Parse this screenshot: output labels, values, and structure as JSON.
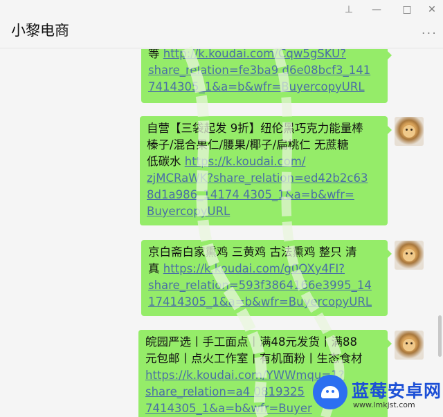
{
  "window": {
    "pin_icon": "⊥",
    "minimize_icon": "—",
    "maximize_icon": "□",
    "close_icon": "✕"
  },
  "header": {
    "title": "小黎电商",
    "more_icon": "···"
  },
  "messages": [
    {
      "lines": [
        {
          "text": "等 ",
          "link": "http://k.koudai.com/Cqw5gSKU?"
        },
        {
          "link": "share_relation=fe3ba9 d6e08bcf3_141"
        },
        {
          "link": "7414305_1&a=b&wfr=BuyercopyURL"
        }
      ]
    },
    {
      "lines": [
        {
          "text": "自营【三袋起发 9折】纽伦黑巧克力能量棒"
        },
        {
          "text": " 榛子/混合果仁/腰果/椰子/扁桃仁 无蔗糖"
        },
        {
          "text": "低碳水 ",
          "link": "https://k.koudai.com/"
        },
        {
          "link": "zjMCRaWK?share_relation=ed42b2c63"
        },
        {
          "link": "8d1a986_14174 4305_1&a=b&wfr="
        },
        {
          "link": "BuyercopyURL"
        }
      ]
    },
    {
      "lines": [
        {
          "text": "京白斋白家熏鸡 三黄鸡 古法熏鸡 整只 清"
        },
        {
          "text": "真 ",
          "link": "https://k.koudai.com/g0OXy4FI?"
        },
        {
          "link": "share_relation=593f3864166e3995_14"
        },
        {
          "link": "17414305_1&a=b&wfr=BuyercopyURL"
        }
      ]
    },
    {
      "lines": [
        {
          "text": "皖园严选丨手工面点丨满48元发货丨满88"
        },
        {
          "text": "元包邮丨点火工作室丨有机面粉丨生态食材"
        },
        {
          "text": " ",
          "link": "https://k.koudai.com/YWWmqu=1?"
        },
        {
          "link": "share_relation=a4 0819325"
        },
        {
          "link": "7414305_1&a=b&wfr=Buyer"
        }
      ]
    }
  ],
  "watermark_brand": {
    "name": "蓝莓安卓网",
    "url": "www.lmkjst.com"
  },
  "colors": {
    "bubble": "#95ec69",
    "link": "#4a6fa5",
    "background": "#f5f5f5",
    "brand_blue": "#1c4fd6"
  }
}
